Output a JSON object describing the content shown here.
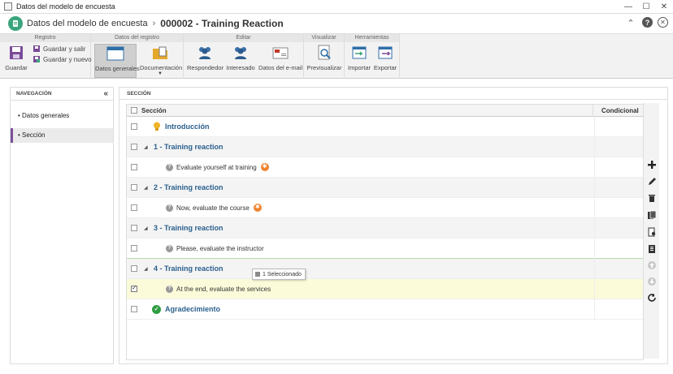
{
  "window": {
    "title": "Datos del modelo de encuesta",
    "controls": {
      "minimize": "—",
      "maximize": "☐",
      "close": "✕"
    }
  },
  "header": {
    "breadcrumb": "Datos del modelo de encuesta",
    "separator": "›",
    "record_title": "000002 - Training Reaction",
    "actions": {
      "collapse": "⌃",
      "help": "?",
      "close": "✕"
    }
  },
  "ribbon": {
    "groups": {
      "registro": "Registro",
      "datos_registro": "Datos del registro",
      "editar": "Editar",
      "visualizar": "Visualizar",
      "herramientas": "Herramientas"
    },
    "buttons": {
      "guardar": "Guardar",
      "guardar_salir": "Guardar y salir",
      "guardar_nuevo": "Guardar y nuevo",
      "datos_generales": "Datos generales",
      "documentacion": "Documentación",
      "respondedor": "Respondedor",
      "interesado": "Interesado",
      "datos_email": "Datos del e-mail",
      "previsualizar": "Previsualizar",
      "importar": "Importar",
      "exportar": "Exportar"
    }
  },
  "nav": {
    "title": "NAVEGACIÓN",
    "collapse": "«",
    "items": [
      "Datos generales",
      "Sección"
    ]
  },
  "main": {
    "title": "SECCIÓN",
    "columns": {
      "section": "Sección",
      "conditional": "Condicional"
    },
    "rows": {
      "intro": "Introducción",
      "s1": "1 - Training reaction",
      "q1": "Evaluate yourself at training",
      "s2": "2 - Training reaction",
      "q2": "Now, evaluate the course",
      "s3": "3 - Training reaction",
      "q3": "Please, evaluate the instructor",
      "s4": "4 - Training reaction",
      "q4": "At the end, evaluate the services",
      "thanks": "Agradecimiento"
    },
    "caret": "◢",
    "q_mark": "?",
    "thanks_check": "✓",
    "tooltip": "1 Seleccionado"
  },
  "colors": {
    "accent": "#7d4f9b",
    "section_title": "#2a5f8e",
    "selected_row": "#fbfbda",
    "badge": "#f08330",
    "success": "#2f9e44",
    "logo": "#3aa57c"
  }
}
